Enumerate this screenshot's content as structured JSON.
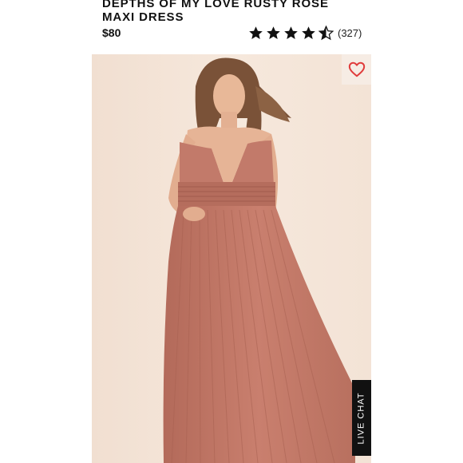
{
  "product": {
    "title": "DEPTHS OF MY LOVE RUSTY ROSE MAXI DRESS",
    "price": "$80",
    "rating": 4.5,
    "review_count": "(327)"
  },
  "image": {
    "dress_color": "#c47a6a",
    "background_color": "#f4e4d7"
  },
  "icons": {
    "favorite": "heart-icon",
    "star": "star-icon"
  },
  "live_chat": {
    "label": "LIVE CHAT"
  }
}
